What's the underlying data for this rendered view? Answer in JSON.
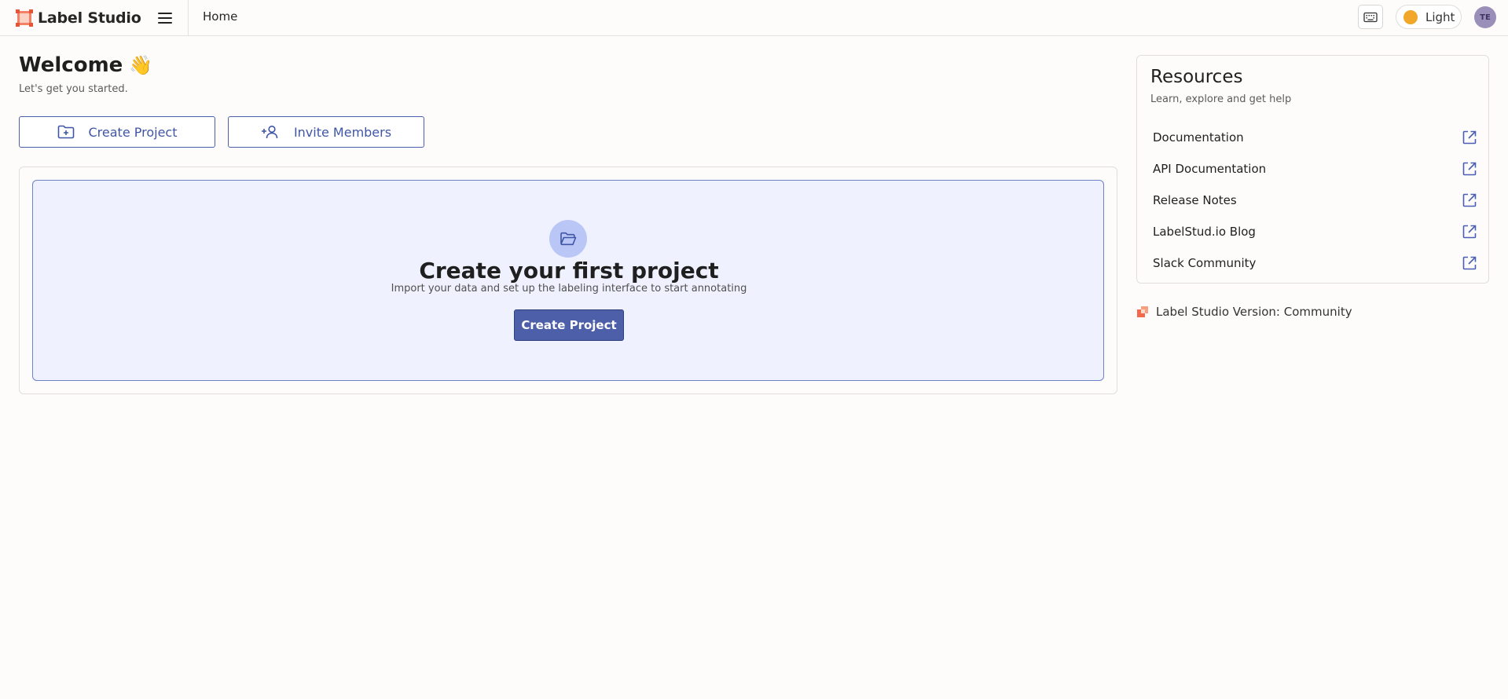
{
  "header": {
    "brand_name": "Label Studio",
    "breadcrumb": "Home",
    "theme_label": "Light",
    "avatar_initials": "TE"
  },
  "welcome": {
    "title": "Welcome",
    "emoji": "👋",
    "subtitle": "Let's get you started."
  },
  "actions": {
    "create_project_label": "Create Project",
    "invite_members_label": "Invite Members"
  },
  "empty_state": {
    "title": "Create your first project",
    "subtitle": "Import your data and set up the labeling interface to start annotating",
    "button_label": "Create Project"
  },
  "resources": {
    "title": "Resources",
    "subtitle": "Learn, explore and get help",
    "items": [
      {
        "label": "Documentation"
      },
      {
        "label": "API Documentation"
      },
      {
        "label": "Release Notes"
      },
      {
        "label": "LabelStud.io Blog"
      },
      {
        "label": "Slack Community"
      }
    ]
  },
  "version": {
    "text": "Label Studio Version: Community"
  },
  "colors": {
    "accent": "#4d5fa8",
    "brand_orange": "#f26a4b",
    "empty_bg": "#eff2fe"
  },
  "icons": {
    "brand": "label-studio-logo-icon",
    "menu": "hamburger-menu-icon",
    "keyboard": "keyboard-icon",
    "theme": "sun-icon",
    "create_project": "folder-plus-icon",
    "invite": "user-plus-icon",
    "empty": "folder-open-icon",
    "external": "external-link-icon"
  }
}
